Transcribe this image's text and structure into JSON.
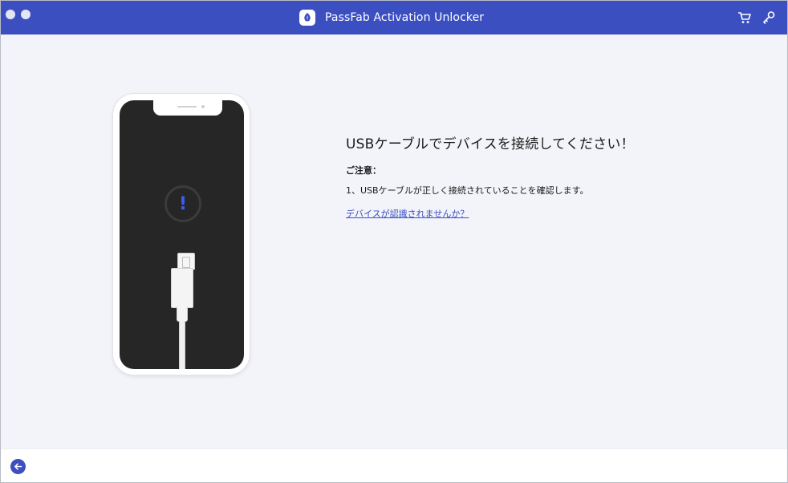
{
  "window": {
    "title": "PassFab Activation Unlocker",
    "icons": {
      "logo": "passfab-logo-icon",
      "cart": "cart-icon",
      "key": "key-icon",
      "back": "back-arrow-icon"
    },
    "colors": {
      "titlebar": "#3c4fc1",
      "accent": "#3c4fc1",
      "link": "#3a4bc3",
      "background": "#f3f4f9"
    }
  },
  "illustration": {
    "alert_glyph": "!"
  },
  "main": {
    "heading": "USBケーブルでデバイスを接続してください！",
    "note_title": "ご注意：",
    "notes": [
      "1、USBケーブルが正しく接続されていることを確認します。"
    ],
    "help_link": "デバイスが認識されませんか？"
  }
}
